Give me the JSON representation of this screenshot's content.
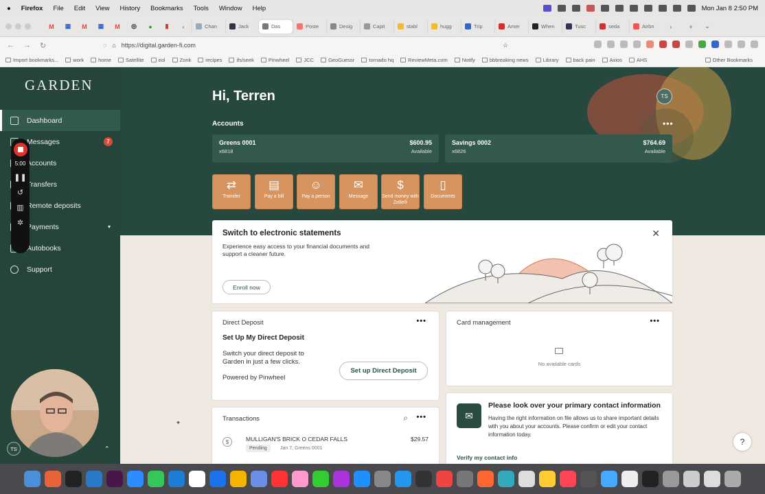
{
  "menubar": {
    "app": "Firefox",
    "items": [
      "File",
      "Edit",
      "View",
      "History",
      "Bookmarks",
      "Tools",
      "Window",
      "Help"
    ],
    "datetime": "Mon Jan 8  2:50 PM"
  },
  "tabs": [
    "Chan",
    "Jack",
    "Das",
    "Poste",
    "Desig",
    "Capit",
    "stabl",
    "hugg",
    "Trip",
    "Amer",
    "When",
    "Tusc",
    "seda",
    "Airbn"
  ],
  "address": {
    "url": "https://digital.garden-fi.com"
  },
  "bookmarks": [
    "Import bookmarks...",
    "work",
    "home",
    "Satellite",
    "eol",
    "Zonk",
    "recipes",
    "ifs/seek",
    "Pinwheel",
    "JCC",
    "GeoGuessr",
    "tornado hq",
    "ReviewMeta.com",
    "Notify",
    "bbbreaking news",
    "Library",
    "back pain",
    "Axios",
    "AHS",
    "Other Bookmarks"
  ],
  "sidebar": {
    "logo": "GARDEN",
    "items": [
      {
        "label": "Dashboard"
      },
      {
        "label": "Messages",
        "badge": "7"
      },
      {
        "label": "Accounts"
      },
      {
        "label": "Transfers"
      },
      {
        "label": "Remote deposits"
      },
      {
        "label": "Payments"
      },
      {
        "label": "Autobooks"
      },
      {
        "label": "Support"
      }
    ],
    "user_initials": "TS"
  },
  "recorder": {
    "time": "5:00"
  },
  "header": {
    "greeting": "Hi, Terren",
    "avatar": "TS"
  },
  "accounts": {
    "title": "Accounts",
    "list": [
      {
        "name": "Greens 0001",
        "number": "x6818",
        "amount": "$600.95",
        "status": "Available"
      },
      {
        "name": "Savings 0002",
        "number": "x6826",
        "amount": "$764.69",
        "status": "Available"
      }
    ]
  },
  "actions": [
    {
      "icon": "⇄",
      "label": "Transfer"
    },
    {
      "icon": "▤",
      "label": "Pay a bill"
    },
    {
      "icon": "☺",
      "label": "Pay a person"
    },
    {
      "icon": "✉",
      "label": "Message"
    },
    {
      "icon": "$",
      "label": "Send money with Zelle®"
    },
    {
      "icon": "▯",
      "label": "Documents"
    }
  ],
  "promo": {
    "title": "Switch to electronic statements",
    "desc": "Experience easy access to your financial documents and support a cleaner future.",
    "button": "Enroll now"
  },
  "direct_deposit": {
    "title": "Direct Deposit",
    "heading": "Set Up My Direct Deposit",
    "body": "Switch your direct deposit to Garden in just a few clicks.",
    "powered": "Powered by Pinwheel",
    "button": "Set up Direct Deposit"
  },
  "card_management": {
    "title": "Card management",
    "empty": "No available cards"
  },
  "transactions": {
    "title": "Transactions",
    "rows": [
      {
        "merchant": "MULLIGAN'S BRICK O CEDAR FALLS",
        "amount": "$29.57",
        "status": "Pending",
        "meta": "Jan 7, Greens 0001"
      }
    ]
  },
  "contact": {
    "title": "Please look over your primary contact information",
    "body": "Having the right information on file allows us to share important details with you about your accounts. Please confirm or edit your contact information today.",
    "link": "Verify my contact info"
  },
  "help": "?",
  "colors": {
    "sidebar": "#25443a",
    "hero": "#27483e",
    "accent": "#d8945e",
    "page": "#efe9e2"
  }
}
